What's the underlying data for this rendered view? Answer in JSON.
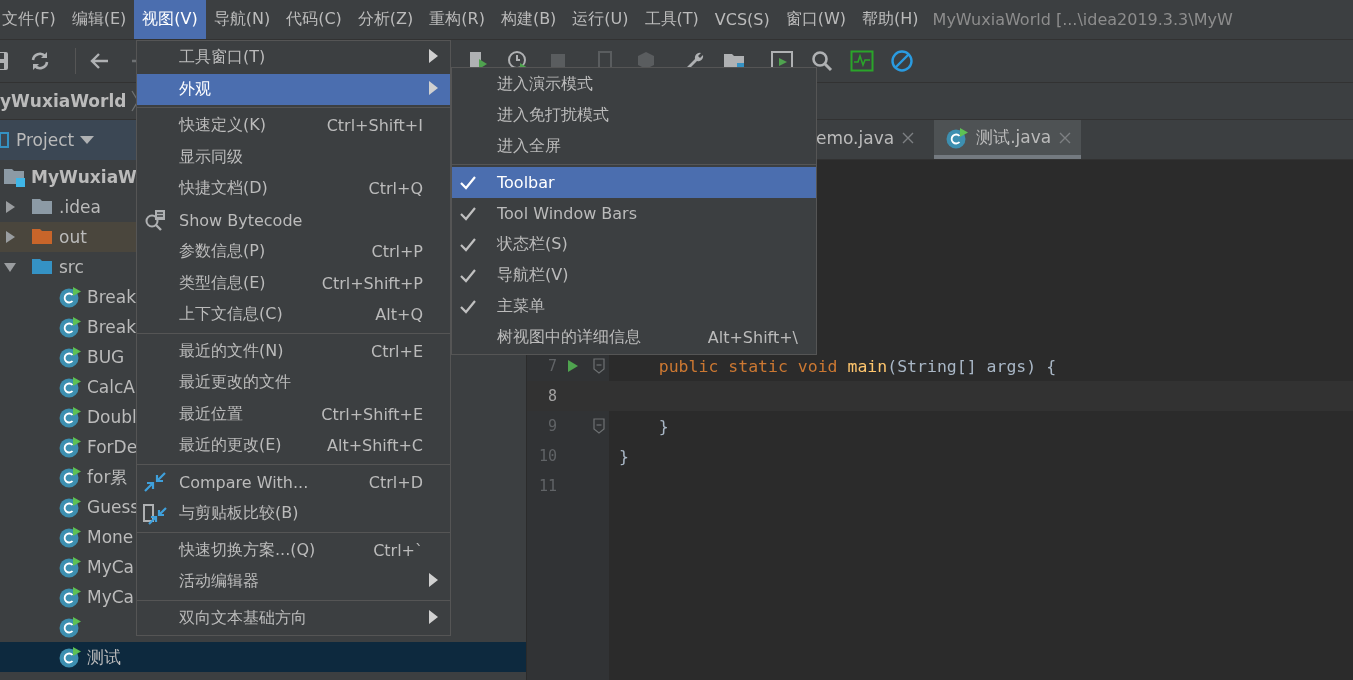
{
  "menubar": {
    "items": [
      {
        "label": "文件(F)",
        "selected": false
      },
      {
        "label": "编辑(E)",
        "selected": false
      },
      {
        "label": "视图(V)",
        "selected": true
      },
      {
        "label": "导航(N)",
        "selected": false
      },
      {
        "label": "代码(C)",
        "selected": false
      },
      {
        "label": "分析(Z)",
        "selected": false
      },
      {
        "label": "重构(R)",
        "selected": false
      },
      {
        "label": "构建(B)",
        "selected": false
      },
      {
        "label": "运行(U)",
        "selected": false
      },
      {
        "label": "工具(T)",
        "selected": false
      },
      {
        "label": "VCS(S)",
        "selected": false
      },
      {
        "label": "窗口(W)",
        "selected": false
      },
      {
        "label": "帮助(H)",
        "selected": false
      }
    ],
    "title": "MyWuxiaWorld [...\\idea2019.3.3\\MyW"
  },
  "navbar": {
    "crumb": "yWuxiaWorld"
  },
  "project_panel": {
    "title": "Project",
    "tree": [
      {
        "label": "MyWuxiaW",
        "kind": "module",
        "selected": false,
        "children": [
          {
            "label": ".idea",
            "kind": "folder",
            "color": "#8c9aa5",
            "expanded": false,
            "highlighted": false,
            "selected": false
          },
          {
            "label": "out",
            "kind": "folder",
            "color": "#c8652a",
            "expanded": false,
            "highlighted": true,
            "selected": false
          },
          {
            "label": "src",
            "kind": "folder",
            "color": "#3592c4",
            "expanded": true,
            "highlighted": false,
            "selected": false,
            "children": [
              {
                "label": "Break",
                "kind": "class",
                "selected": false
              },
              {
                "label": "Break",
                "kind": "class",
                "selected": false
              },
              {
                "label": "BUG",
                "kind": "class",
                "selected": false
              },
              {
                "label": "CalcA",
                "kind": "class",
                "selected": false
              },
              {
                "label": "Doubl",
                "kind": "class",
                "selected": false
              },
              {
                "label": "ForDe",
                "kind": "class",
                "selected": false
              },
              {
                "label": "for累",
                "kind": "class",
                "selected": false
              },
              {
                "label": "Guess",
                "kind": "class",
                "selected": false
              },
              {
                "label": "Mone",
                "kind": "class",
                "selected": false
              },
              {
                "label": "MyCa",
                "kind": "class",
                "selected": false
              },
              {
                "label": "MyCa",
                "kind": "class",
                "selected": false
              },
              {
                "kind": "class",
                "selected": false
              },
              {
                "label": "测试",
                "kind": "class",
                "selected": true
              }
            ]
          }
        ]
      }
    ]
  },
  "editor": {
    "tabs": [
      {
        "label": "emo.java",
        "selected": false,
        "icon": false
      },
      {
        "label": "测试.java",
        "selected": true,
        "icon": true
      }
    ],
    "lines": [
      {
        "number": "7",
        "current": false,
        "run": true,
        "fold": true,
        "tokens": [
          {
            "kind": "keyword",
            "text": "    public static void "
          },
          {
            "kind": "function",
            "text": "main"
          },
          {
            "kind": "plain",
            "text": "(String[] args) {"
          }
        ]
      },
      {
        "number": "8",
        "current": true,
        "run": false,
        "fold": false
      },
      {
        "number": "9",
        "current": false,
        "run": false,
        "fold": true,
        "tokens": [
          {
            "kind": "plain",
            "text": "    }"
          }
        ]
      },
      {
        "number": "10",
        "current": false,
        "run": false,
        "fold": false,
        "tokens": [
          {
            "kind": "plain",
            "text": "}"
          }
        ]
      },
      {
        "number": "11",
        "current": false,
        "run": false,
        "fold": false
      }
    ]
  },
  "view_menu": {
    "items": [
      {
        "kind": "item",
        "label": "工具窗口(T)",
        "submenu": true,
        "selected": false
      },
      {
        "kind": "item",
        "label": "外观",
        "submenu": true,
        "selected": true
      },
      {
        "kind": "separator"
      },
      {
        "kind": "item",
        "label": "快速定义(K)",
        "shortcut": "Ctrl+Shift+I",
        "submenu": false,
        "selected": false
      },
      {
        "kind": "item",
        "label": "显示同级",
        "submenu": false,
        "selected": false
      },
      {
        "kind": "item",
        "label": "快捷文档(D)",
        "shortcut": "Ctrl+Q",
        "submenu": false,
        "selected": false
      },
      {
        "kind": "item",
        "label": "Show Bytecode",
        "submenu": false,
        "selected": false
      },
      {
        "kind": "item",
        "label": "参数信息(P)",
        "shortcut": "Ctrl+P",
        "submenu": false,
        "selected": false
      },
      {
        "kind": "item",
        "label": "类型信息(E)",
        "shortcut": "Ctrl+Shift+P",
        "submenu": false,
        "selected": false
      },
      {
        "kind": "item",
        "label": "上下文信息(C)",
        "shortcut": "Alt+Q",
        "submenu": false,
        "selected": false
      },
      {
        "kind": "separator"
      },
      {
        "kind": "item",
        "label": "最近的文件(N)",
        "shortcut": "Ctrl+E",
        "submenu": false,
        "selected": false
      },
      {
        "kind": "item",
        "label": "最近更改的文件",
        "submenu": false,
        "selected": false
      },
      {
        "kind": "item",
        "label": "最近位置",
        "shortcut": "Ctrl+Shift+E",
        "submenu": false,
        "selected": false
      },
      {
        "kind": "item",
        "label": "最近的更改(E)",
        "shortcut": "Alt+Shift+C",
        "submenu": false,
        "selected": false
      },
      {
        "kind": "separator"
      },
      {
        "kind": "item",
        "label": "Compare With...",
        "shortcut": "Ctrl+D",
        "submenu": false,
        "selected": false
      },
      {
        "kind": "item",
        "label": "与剪贴板比较(B)",
        "submenu": false,
        "selected": false
      },
      {
        "kind": "separator"
      },
      {
        "kind": "item",
        "label": "快速切换方案...(Q)",
        "shortcut": "Ctrl+`",
        "submenu": false,
        "selected": false
      },
      {
        "kind": "item",
        "label": "活动编辑器",
        "submenu": true,
        "selected": false
      },
      {
        "kind": "separator"
      },
      {
        "kind": "item",
        "label": "双向文本基础方向",
        "submenu": true,
        "selected": false
      }
    ]
  },
  "appearance_submenu": {
    "items": [
      {
        "kind": "item",
        "label": "进入演示模式",
        "checked": false,
        "selected": false
      },
      {
        "kind": "item",
        "label": "进入免打扰模式",
        "checked": false,
        "selected": false
      },
      {
        "kind": "item",
        "label": "进入全屏",
        "checked": false,
        "selected": false
      },
      {
        "kind": "separator"
      },
      {
        "kind": "item",
        "label": "Toolbar",
        "checked": true,
        "selected": true
      },
      {
        "kind": "item",
        "label": "Tool Window Bars",
        "checked": true,
        "selected": false
      },
      {
        "kind": "item",
        "label": "状态栏(S)",
        "checked": true,
        "selected": false
      },
      {
        "kind": "item",
        "label": "导航栏(V)",
        "checked": true,
        "selected": false
      },
      {
        "kind": "item",
        "label": "主菜单",
        "checked": true,
        "selected": false
      },
      {
        "kind": "item",
        "label": "树视图中的详细信息",
        "shortcut": "Alt+Shift+\\",
        "checked": false,
        "selected": false
      }
    ]
  }
}
